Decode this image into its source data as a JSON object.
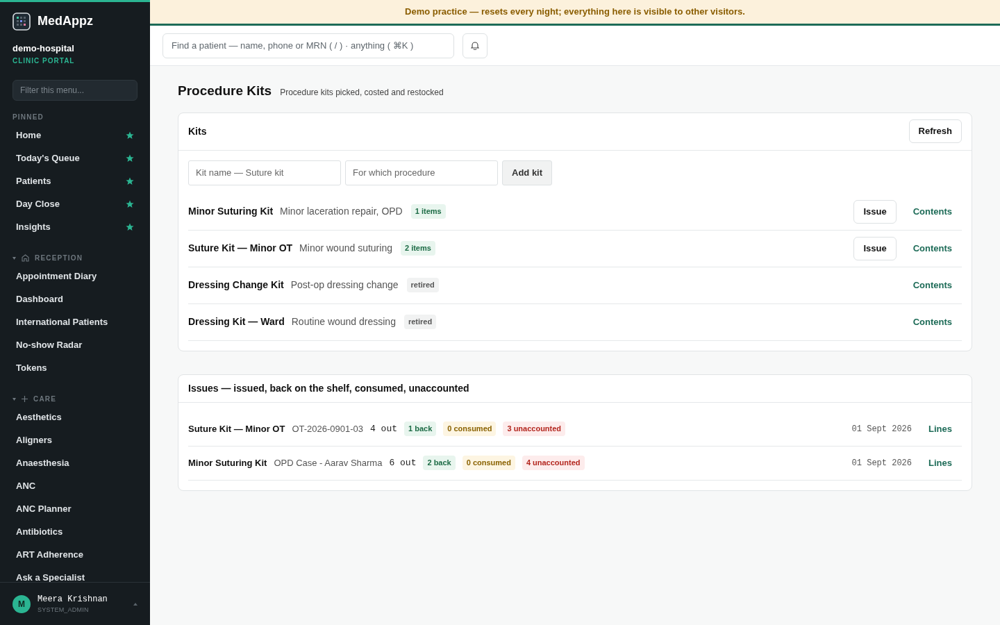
{
  "brand": {
    "name": "MedAppz",
    "org": "demo-hospital",
    "portal": "CLINIC PORTAL"
  },
  "sidebar": {
    "filter_placeholder": "Filter this menu...",
    "sections": [
      {
        "kind": "pinned",
        "title": "PINNED",
        "items": [
          {
            "label": "Home",
            "starred": true
          },
          {
            "label": "Today's Queue",
            "starred": true
          },
          {
            "label": "Patients",
            "starred": true
          },
          {
            "label": "Day Close",
            "starred": true
          },
          {
            "label": "Insights",
            "starred": true
          }
        ]
      },
      {
        "kind": "group",
        "title": "RECEPTION",
        "expanded": true,
        "items": [
          {
            "label": "Appointment Diary"
          },
          {
            "label": "Dashboard"
          },
          {
            "label": "International Patients"
          },
          {
            "label": "No-show Radar"
          },
          {
            "label": "Tokens"
          }
        ]
      },
      {
        "kind": "group",
        "title": "CARE",
        "expanded": true,
        "items": [
          {
            "label": "Aesthetics"
          },
          {
            "label": "Aligners"
          },
          {
            "label": "Anaesthesia"
          },
          {
            "label": "ANC"
          },
          {
            "label": "ANC Planner"
          },
          {
            "label": "Antibiotics"
          },
          {
            "label": "ART Adherence"
          },
          {
            "label": "Ask a Specialist"
          }
        ]
      }
    ]
  },
  "user": {
    "initial": "M",
    "name": "Meera Krishnan",
    "role": "SYSTEM_ADMIN"
  },
  "banner": "Demo practice — resets every night; everything here is visible to other visitors.",
  "search": {
    "placeholder": "Find a patient — name, phone or MRN ( / ) · anything ( ⌘K )"
  },
  "page": {
    "title": "Procedure Kits",
    "subtitle": "Procedure kits picked, costed and restocked"
  },
  "kits": {
    "title": "Kits",
    "refresh": "Refresh",
    "name_placeholder": "Kit name — Suture kit",
    "procedure_placeholder": "For which procedure",
    "add": "Add kit",
    "rows": [
      {
        "kind": "active",
        "name": "Minor Suturing Kit",
        "procedure": "Minor laceration repair, OPD",
        "badge": "1 items",
        "issue": "Issue",
        "contents": "Contents"
      },
      {
        "kind": "active",
        "name": "Suture Kit — Minor OT",
        "procedure": "Minor wound suturing",
        "badge": "2 items",
        "issue": "Issue",
        "contents": "Contents"
      },
      {
        "kind": "retired",
        "name": "Dressing Change Kit",
        "procedure": "Post-op dressing change",
        "badge": "retired",
        "contents": "Contents"
      },
      {
        "kind": "retired",
        "name": "Dressing Kit — Ward",
        "procedure": "Routine wound dressing",
        "badge": "retired",
        "contents": "Contents"
      }
    ]
  },
  "issues": {
    "title": "Issues — issued, back on the shelf, consumed, unaccounted",
    "rows": [
      {
        "kit": "Suture Kit — Minor OT",
        "ref": "OT-2026-0901-03",
        "out": "4 out",
        "back": "1 back",
        "consumed": "0 consumed",
        "unaccounted": "3 unaccounted",
        "date": "01 Sept 2026",
        "link": "Lines"
      },
      {
        "kit": "Minor Suturing Kit",
        "ref": "OPD Case - Aarav Sharma",
        "out": "6 out",
        "back": "2 back",
        "consumed": "0 consumed",
        "unaccounted": "4 unaccounted",
        "date": "01 Sept 2026",
        "link": "Lines"
      }
    ]
  }
}
